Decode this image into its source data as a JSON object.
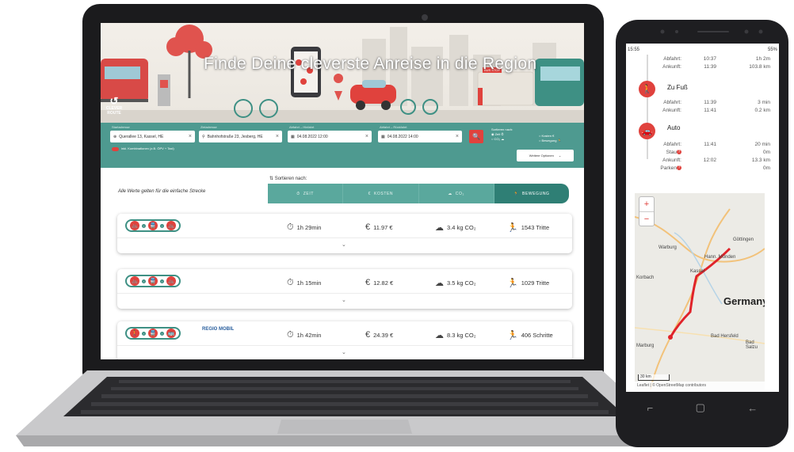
{
  "laptop": {
    "hero": {
      "title": "Finde Deine cleverste Anreise in die Region",
      "logo_text": "CLEVER ROUTE",
      "bus_stop_sign": "BUS STOP"
    },
    "search": {
      "labels": {
        "from": "Startadresse",
        "to": "Zieladresse",
        "depart": "Abfahrt – Hinfahrt",
        "return": "Abfahrt – Rückfahrt"
      },
      "from_value": "Querallee 13, Kassel, HE",
      "to_value": "Bahnhofstraße 23, Jesberg, HE",
      "depart_value": "04.08.2022 12:00",
      "return_value": "04.08.2022 14:00",
      "clear_icon": "×",
      "search_icon": "🔍",
      "sort_title": "Sortieren nach:",
      "sort_options": [
        "Zeit",
        "CO₂",
        "Kosten",
        "Bewegung"
      ],
      "toggle_label": "inkl. Kombinationen (z.B. ÖPV + Taxi)",
      "more_options": "Weitere Optionen",
      "chevron": "⌄"
    },
    "results_header": {
      "note": "Alle Werte gelten für die einfache Strecke",
      "sort_heading": "Sortieren nach:",
      "tabs": [
        {
          "label": "ZEIT",
          "icon": "⏱",
          "active": false
        },
        {
          "label": "KOSTEN",
          "icon": "€",
          "active": false
        },
        {
          "label": "CO₂",
          "icon": "☁",
          "active": false
        },
        {
          "label": "BEWEGUNG",
          "icon": "🏃",
          "active": true
        }
      ]
    },
    "results": [
      {
        "modes": [
          "🚲",
          "🚆",
          "🚲"
        ],
        "duration": "1h 29min",
        "cost": "11.97 €",
        "co2": "3.4 kg CO₂",
        "movement": "1543 Tritte",
        "chevron": "⌄"
      },
      {
        "modes": [
          "🚲",
          "🚆",
          "🚲"
        ],
        "duration": "1h 15min",
        "cost": "12.82 €",
        "co2": "3.5 kg CO₂",
        "movement": "1029 Tritte",
        "chevron": "⌄"
      },
      {
        "modes": [
          "🚶",
          "🚆",
          "🚌"
        ],
        "provider": "REGIO MOBIL",
        "duration": "1h 42min",
        "cost": "24.39 €",
        "co2": "8.3 kg CO₂",
        "movement": "406 Schritte",
        "chevron": "⌄"
      }
    ],
    "icons": {
      "duration": "⏱",
      "cost": "€",
      "co2": "☁",
      "movement": "🏃"
    }
  },
  "phone": {
    "status": {
      "time": "15:55",
      "battery": "55%"
    },
    "top_partial": {
      "abfahrt_label": "Abfahrt:",
      "abfahrt_time": "10:37",
      "abfahrt_val": "1h 2m",
      "ankunft_label": "Ankunft:",
      "ankunft_time": "11:39",
      "ankunft_val": "103.8 km"
    },
    "walk": {
      "title": "Zu Fuß",
      "abfahrt_label": "Abfahrt:",
      "abfahrt_time": "11:39",
      "abfahrt_val": "3 min",
      "ankunft_label": "Ankunft:",
      "ankunft_time": "11:41",
      "ankunft_val": "0.2 km"
    },
    "car": {
      "title": "Auto",
      "abfahrt_label": "Abfahrt:",
      "abfahrt_time": "11:41",
      "abfahrt_val": "20 min",
      "stau_label": "Stau",
      "stau_val": "0m",
      "ankunft_label": "Ankunft:",
      "ankunft_time": "12:02",
      "ankunft_val": "13.3 km",
      "parken_label": "Parken",
      "parken_val": "0m",
      "info_mark": "?"
    },
    "map": {
      "zoom_in": "+",
      "zoom_out": "−",
      "labels": [
        "Warburg",
        "Göttingen",
        "Hann. Münden",
        "Korbach",
        "Kassel",
        "Bad Hersfeld",
        "Bad Salzu",
        "Marburg"
      ],
      "country": "Germany",
      "scale": "30 km",
      "attribution": "Leaflet | © OpenStreetMap contributors"
    },
    "nav": [
      "⌐",
      "▢",
      "←"
    ]
  }
}
